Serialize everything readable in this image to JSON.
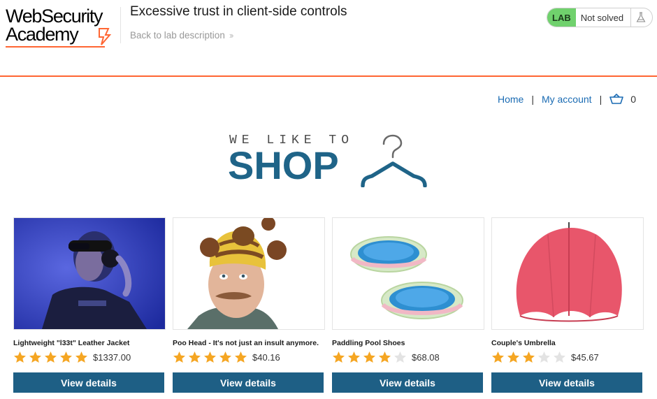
{
  "academy": {
    "logo_line1": "WebSecurity",
    "logo_line2": "Academy",
    "lab_title": "Excessive trust in client-side controls",
    "back_link": "Back to lab description",
    "lab_badge": "LAB",
    "status": "Not solved",
    "accent_color": "#ff6633",
    "status_color": "#70d16d"
  },
  "nav": {
    "home": "Home",
    "separator": "|",
    "my_account": "My account",
    "cart_count": "0"
  },
  "banner": {
    "tagline": "WE LIKE TO",
    "word": "SHOP"
  },
  "products": [
    {
      "name": "Lightweight \"l33t\" Leather Jacket",
      "stars": 5,
      "price": "$1337.00",
      "button": "View details",
      "image": "person-with-headphones-photo"
    },
    {
      "name": "Poo Head - It's not just an insult anymore.",
      "stars": 5,
      "price": "$40.16",
      "button": "View details",
      "image": "man-with-poo-hat-photo"
    },
    {
      "name": "Paddling Pool Shoes",
      "stars": 4,
      "price": "$68.08",
      "button": "View details",
      "image": "inflatable-pools-photo"
    },
    {
      "name": "Couple's Umbrella",
      "stars": 3,
      "price": "$45.67",
      "button": "View details",
      "image": "red-umbrella-photo"
    }
  ],
  "colors": {
    "button": "#1e5f85",
    "link": "#1a6bb3",
    "star_filled": "#f5a623",
    "star_empty": "#e3e3e3"
  }
}
